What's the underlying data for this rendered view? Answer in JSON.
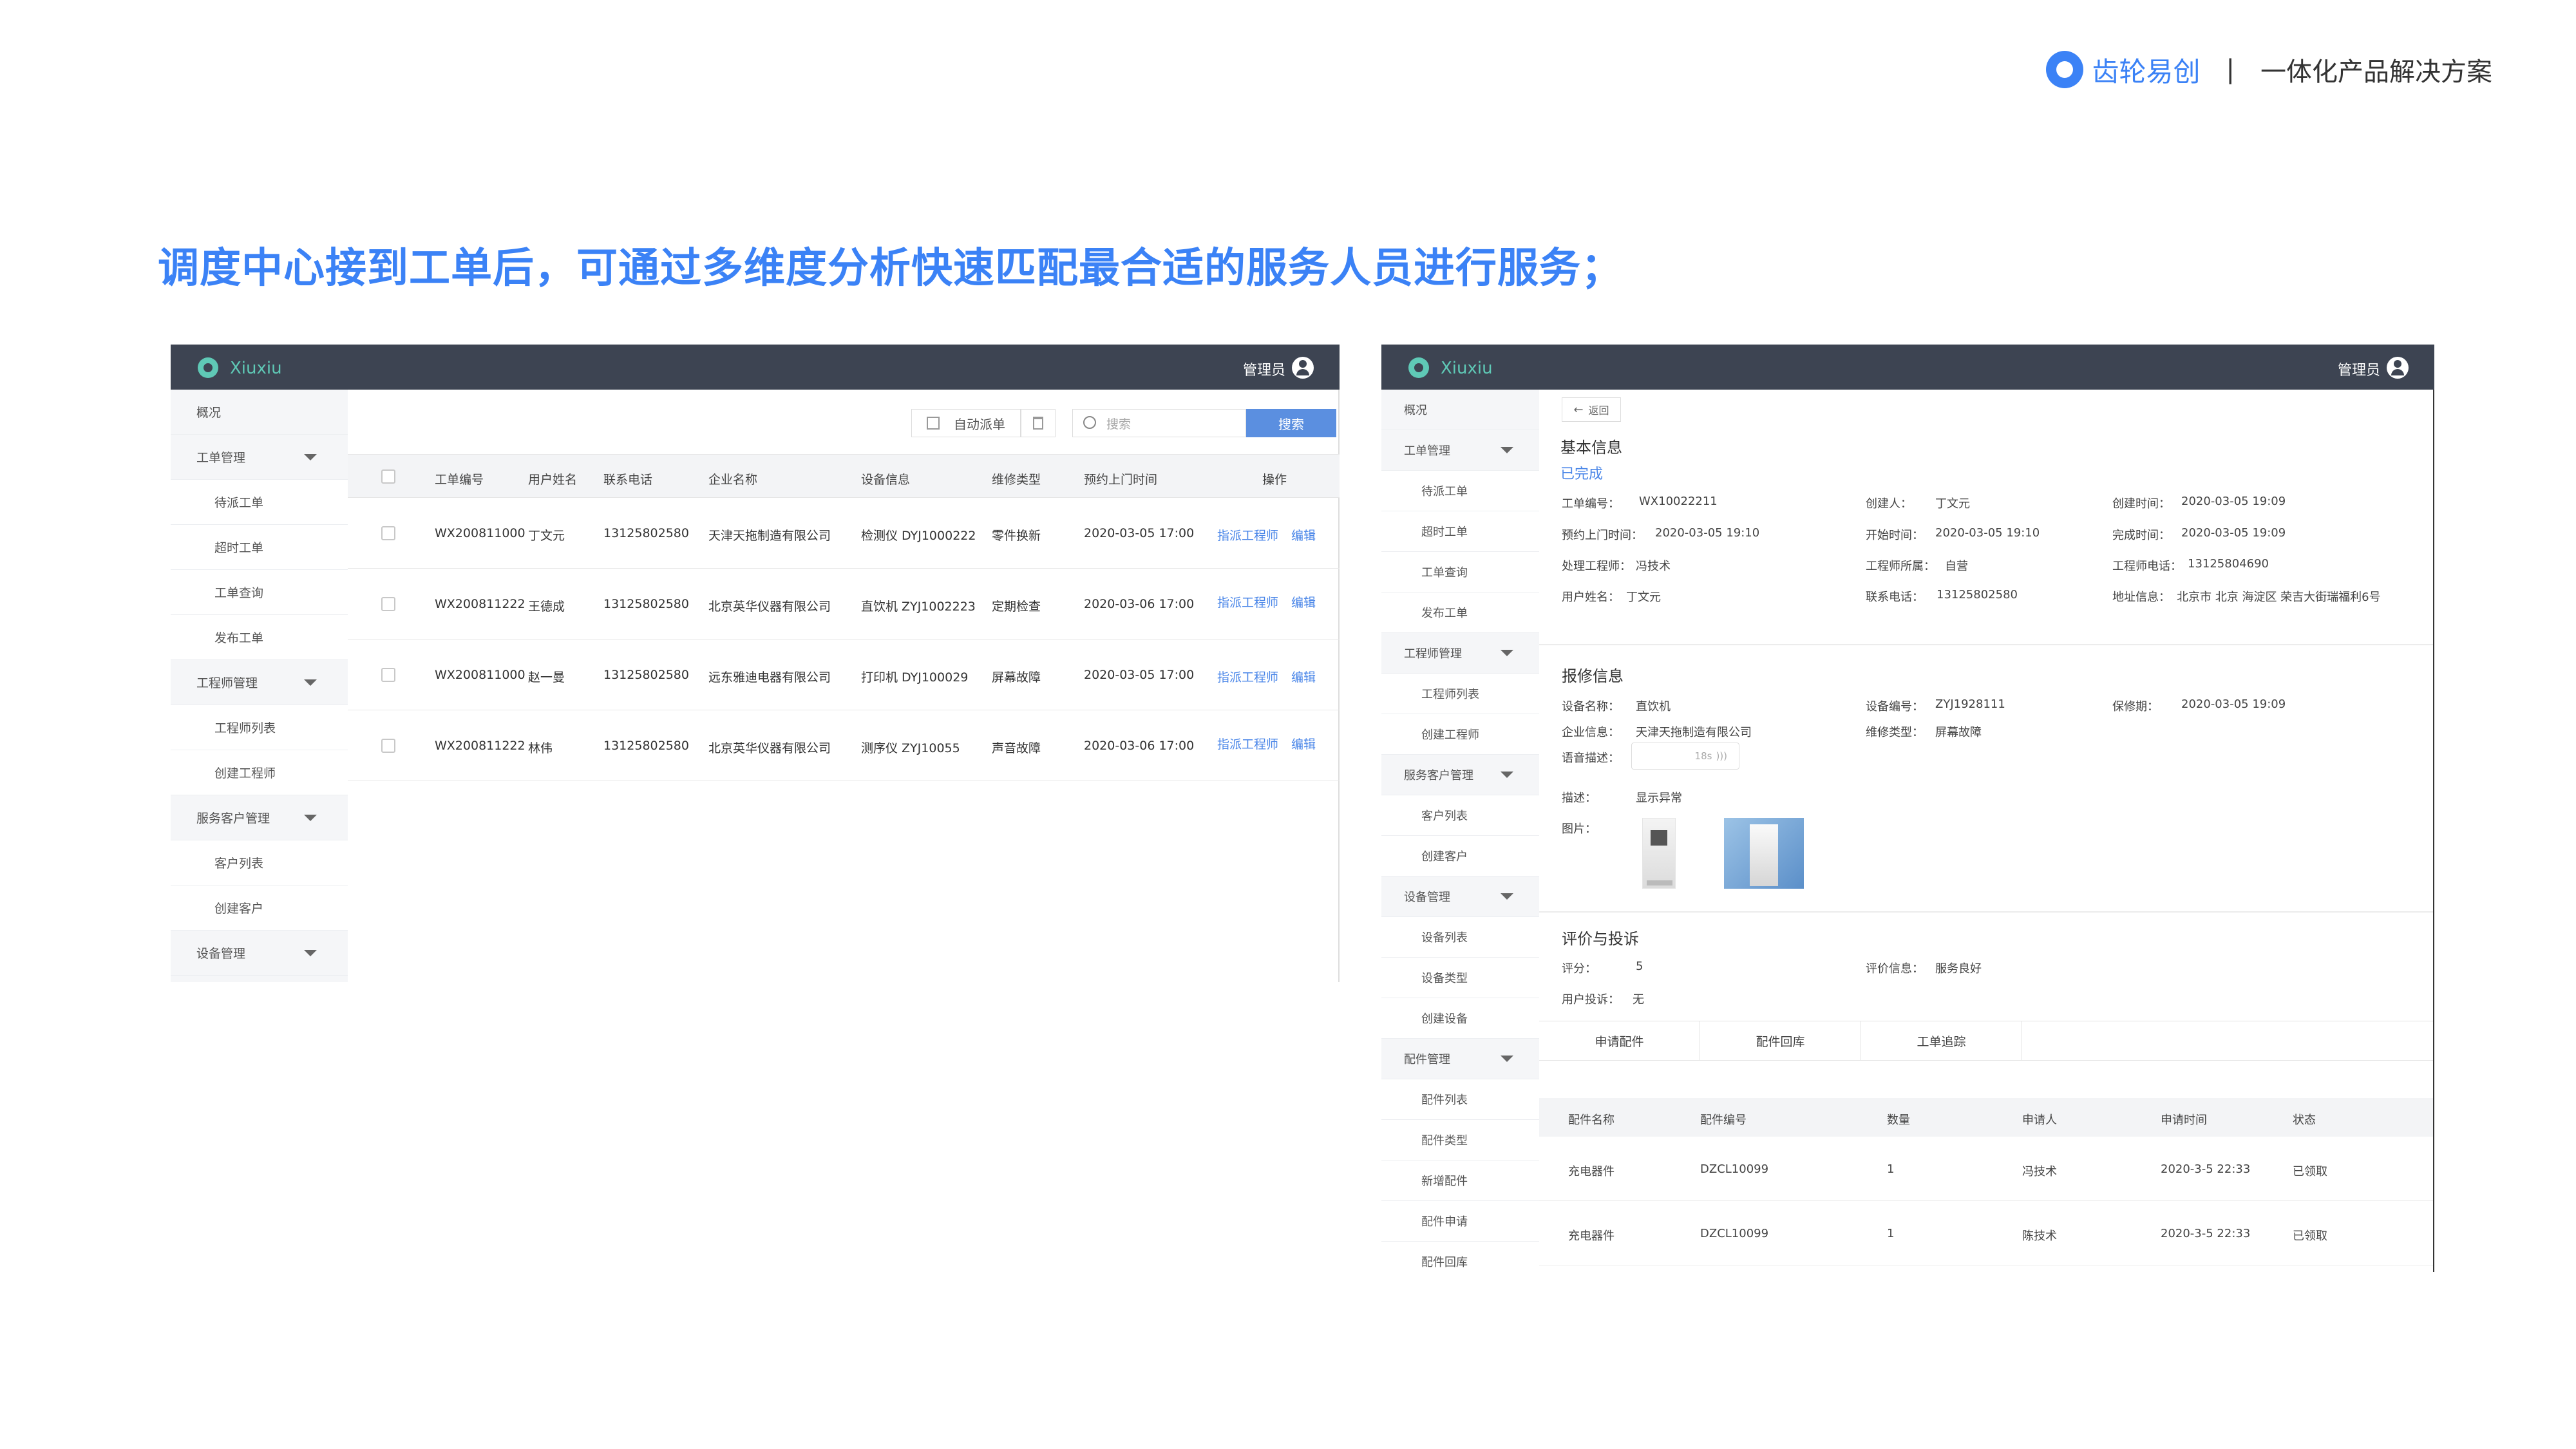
{
  "brand": {
    "name": "齿轮易创",
    "separator": "|",
    "slogan": "一体化产品解决方案"
  },
  "headline": "调度中心接到工单后，可通过多维度分析快速匹配最合适的服务人员进行服务；",
  "app": {
    "title": "Xiuxiu",
    "user": "管理员"
  },
  "win1": {
    "sidebar": [
      {
        "label": "概况",
        "type": "group",
        "arrow": false
      },
      {
        "label": "工单管理",
        "type": "group",
        "arrow": true
      },
      {
        "label": "待派工单",
        "type": "sub"
      },
      {
        "label": "超时工单",
        "type": "sub"
      },
      {
        "label": "工单查询",
        "type": "sub"
      },
      {
        "label": "发布工单",
        "type": "sub"
      },
      {
        "label": "工程师管理",
        "type": "group",
        "arrow": true
      },
      {
        "label": "工程师列表",
        "type": "sub"
      },
      {
        "label": "创建工程师",
        "type": "sub"
      },
      {
        "label": "服务客户管理",
        "type": "group",
        "arrow": true
      },
      {
        "label": "客户列表",
        "type": "sub"
      },
      {
        "label": "创建客户",
        "type": "sub"
      },
      {
        "label": "设备管理",
        "type": "group",
        "arrow": true
      }
    ],
    "toolbar": {
      "auto_dispatch": "自动派单",
      "search_placeholder": "搜索",
      "search_button": "搜索"
    },
    "table": {
      "headers": [
        "工单编号",
        "用户姓名",
        "联系电话",
        "企业名称",
        "设备信息",
        "维修类型",
        "预约上门时间",
        "操作"
      ],
      "rows": [
        [
          "WX200811000",
          "丁文元",
          "13125802580",
          "天津天拖制造有限公司",
          "检测仪 DYJ1000222",
          "零件换新",
          "2020-03-05 17:00"
        ],
        [
          "WX200811222",
          "王德成",
          "13125802580",
          "北京英华仪器有限公司",
          "直饮机 ZYJ1002223",
          "定期检查",
          "2020-03-06 17:00"
        ],
        [
          "WX200811000",
          "赵一曼",
          "13125802580",
          "远东雅迪电器有限公司",
          "打印机 DYJ100029",
          "屏幕故障",
          "2020-03-05 17:00"
        ],
        [
          "WX200811222",
          "林伟",
          "13125802580",
          "北京英华仪器有限公司",
          "测序仪 ZYJ10055",
          "声音故障",
          "2020-03-06 17:00"
        ]
      ],
      "action_assign": "指派工程师",
      "action_edit": "编辑"
    }
  },
  "win2": {
    "sidebar": [
      {
        "label": "概况",
        "type": "group",
        "arrow": false
      },
      {
        "label": "工单管理",
        "type": "group",
        "arrow": true
      },
      {
        "label": "待派工单",
        "type": "sub"
      },
      {
        "label": "超时工单",
        "type": "sub"
      },
      {
        "label": "工单查询",
        "type": "sub"
      },
      {
        "label": "发布工单",
        "type": "sub"
      },
      {
        "label": "工程师管理",
        "type": "group",
        "arrow": true
      },
      {
        "label": "工程师列表",
        "type": "sub"
      },
      {
        "label": "创建工程师",
        "type": "sub"
      },
      {
        "label": "服务客户管理",
        "type": "group",
        "arrow": true
      },
      {
        "label": "客户列表",
        "type": "sub"
      },
      {
        "label": "创建客户",
        "type": "sub"
      },
      {
        "label": "设备管理",
        "type": "group",
        "arrow": true
      },
      {
        "label": "设备列表",
        "type": "sub"
      },
      {
        "label": "设备类型",
        "type": "sub"
      },
      {
        "label": "创建设备",
        "type": "sub"
      },
      {
        "label": "配件管理",
        "type": "group",
        "arrow": true
      },
      {
        "label": "配件列表",
        "type": "sub"
      },
      {
        "label": "配件类型",
        "type": "sub"
      },
      {
        "label": "新增配件",
        "type": "sub"
      },
      {
        "label": "配件申请",
        "type": "sub"
      },
      {
        "label": "配件回库",
        "type": "sub"
      }
    ],
    "back_label": "返回",
    "basic": {
      "title": "基本信息",
      "status": "已完成",
      "order_no_label": "工单编号：",
      "order_no": "WX10022211",
      "creator_label": "创建人：",
      "creator": "丁文元",
      "created_label": "创建时间：",
      "created": "2020-03-05 19:09",
      "appt_label": "预约上门时间：",
      "appt": "2020-03-05 19:10",
      "start_label": "开始时间：",
      "start": "2020-03-05 19:10",
      "finish_label": "完成时间：",
      "finish": "2020-03-05 19:09",
      "engineer_label": "处理工程师：",
      "engineer": "冯技术",
      "affil_label": "工程师所属：",
      "affil": "自营",
      "eng_phone_label": "工程师电话：",
      "eng_phone": "13125804690",
      "user_label": "用户姓名：",
      "user": "丁文元",
      "phone_label": "联系电话：",
      "phone": "13125802580",
      "addr_label": "地址信息：",
      "addr": "北京市 北京 海淀区 荣吉大街瑞福利6号"
    },
    "repair": {
      "title": "报修信息",
      "device_name_label": "设备名称：",
      "device_name": "直饮机",
      "device_no_label": "设备编号：",
      "device_no": "ZYJ1928111",
      "warranty_label": "保修期：",
      "warranty": "2020-03-05 19:09",
      "company_label": "企业信息：",
      "company": "天津天拖制造有限公司",
      "repair_type_label": "维修类型：",
      "repair_type": "屏幕故障",
      "voice_label": "语音描述：",
      "voice_len": "18s",
      "desc_label": "描述：",
      "desc": "显示异常",
      "image_label": "图片："
    },
    "review": {
      "title": "评价与投诉",
      "score_label": "评分：",
      "score": "5",
      "review_label": "评价信息：",
      "review": "服务良好",
      "complaint_label": "用户投诉：",
      "complaint": "无"
    },
    "tabs": [
      "申请配件",
      "配件回库",
      "工单追踪"
    ],
    "parts": {
      "headers": [
        "配件名称",
        "配件编号",
        "数量",
        "申请人",
        "申请时间",
        "状态"
      ],
      "rows": [
        [
          "充电器件",
          "DZCL10099",
          "1",
          "冯技术",
          "2020-3-5 22:33",
          "已领取"
        ],
        [
          "充电器件",
          "DZCL10099",
          "1",
          "陈技术",
          "2020-3-5 22:33",
          "已领取"
        ]
      ]
    }
  }
}
